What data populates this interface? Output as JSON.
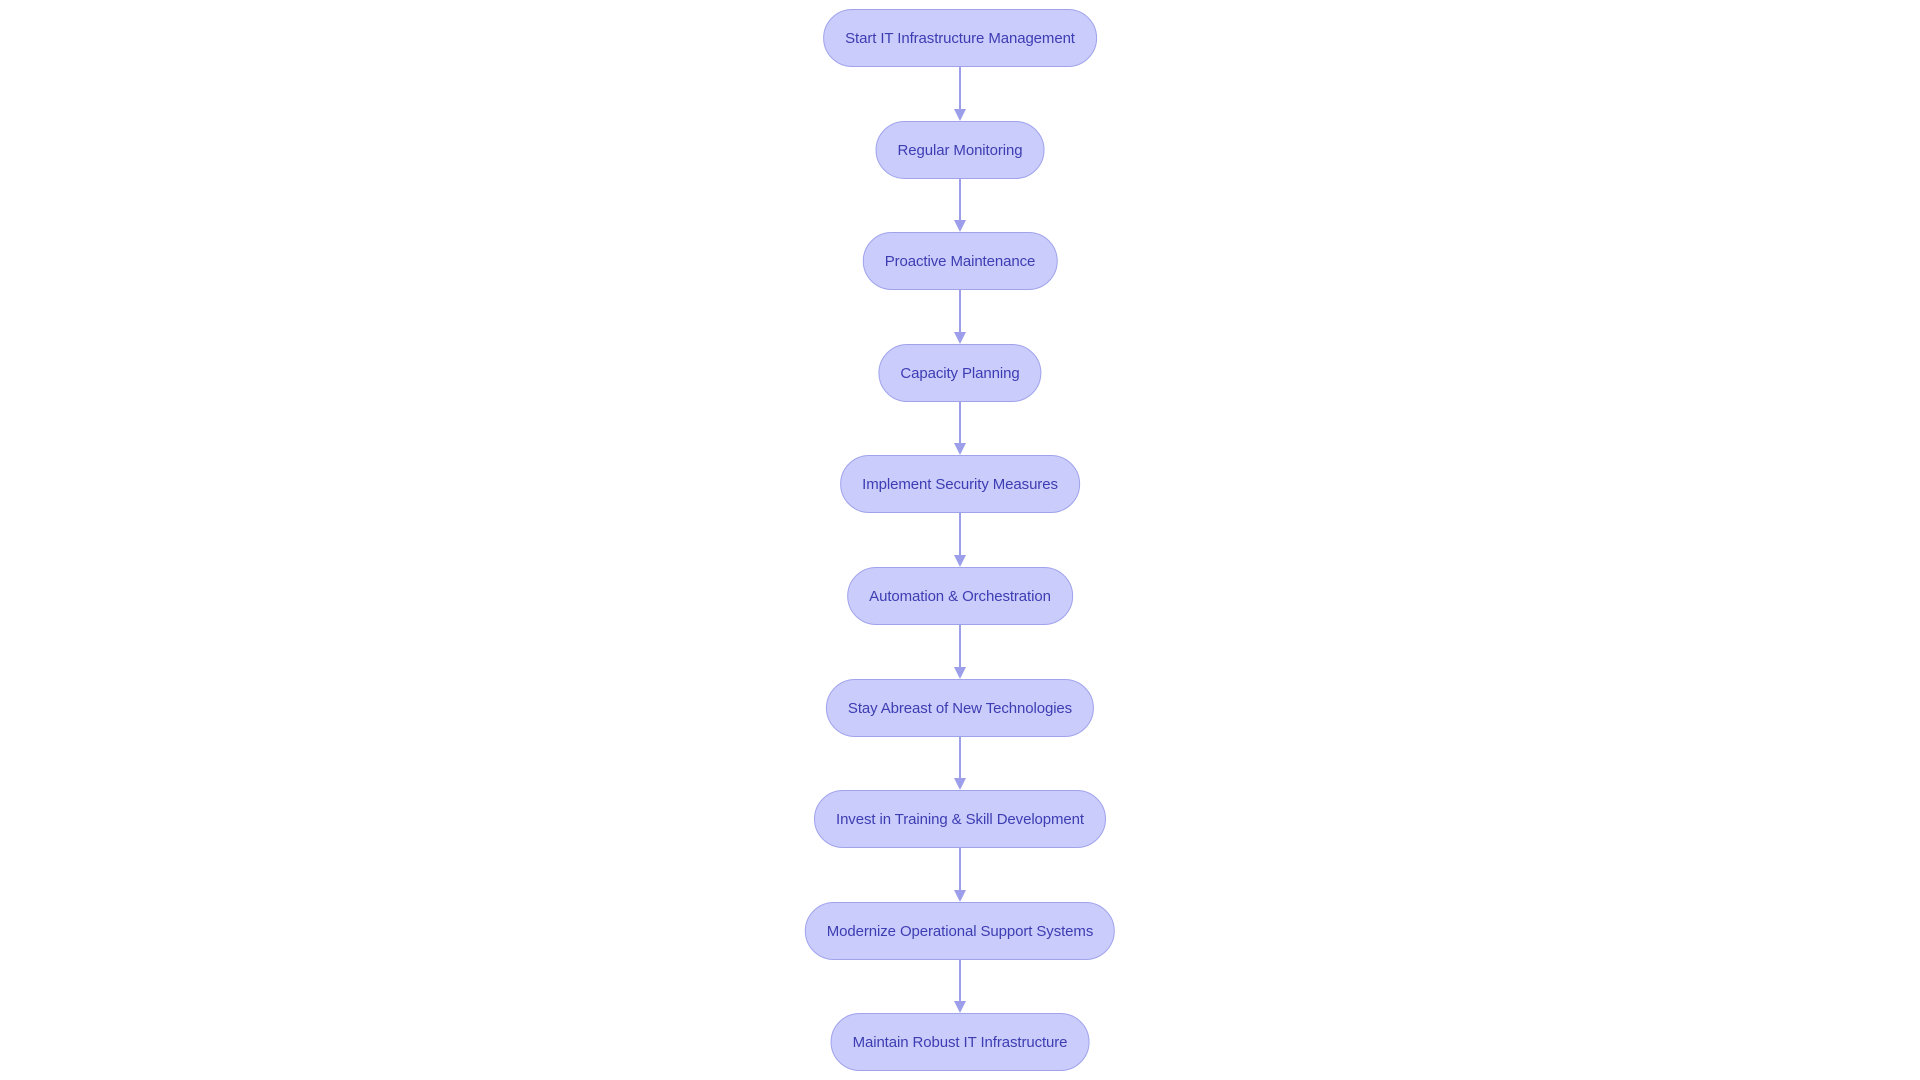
{
  "diagram": {
    "type": "flowchart",
    "direction": "top-to-bottom",
    "colors": {
      "node_fill": "#CACCFB",
      "node_stroke": "#A0A3EC",
      "node_text": "#3D3DB3",
      "edge": "#9C9EEA",
      "background": "#FFFFFF"
    },
    "nodes": [
      {
        "id": "n1",
        "label": "Start IT Infrastructure Management"
      },
      {
        "id": "n2",
        "label": "Regular Monitoring"
      },
      {
        "id": "n3",
        "label": "Proactive Maintenance"
      },
      {
        "id": "n4",
        "label": "Capacity Planning"
      },
      {
        "id": "n5",
        "label": "Implement Security Measures"
      },
      {
        "id": "n6",
        "label": "Automation & Orchestration"
      },
      {
        "id": "n7",
        "label": "Stay Abreast of New Technologies"
      },
      {
        "id": "n8",
        "label": "Invest in Training & Skill Development"
      },
      {
        "id": "n9",
        "label": "Modernize Operational Support Systems"
      },
      {
        "id": "n10",
        "label": "Maintain Robust IT Infrastructure"
      }
    ],
    "edges": [
      {
        "from": "n1",
        "to": "n2"
      },
      {
        "from": "n2",
        "to": "n3"
      },
      {
        "from": "n3",
        "to": "n4"
      },
      {
        "from": "n4",
        "to": "n5"
      },
      {
        "from": "n5",
        "to": "n6"
      },
      {
        "from": "n6",
        "to": "n7"
      },
      {
        "from": "n7",
        "to": "n8"
      },
      {
        "from": "n8",
        "to": "n9"
      },
      {
        "from": "n9",
        "to": "n10"
      }
    ]
  }
}
